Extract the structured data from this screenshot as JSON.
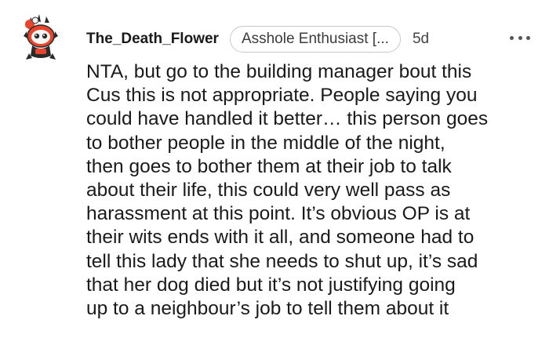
{
  "comment": {
    "author": "The_Death_Flower",
    "flair": "Asshole Enthusiast [...",
    "age": "5d",
    "avatar_icon": "snoo-avatar-icon",
    "more_icon": "more-options-icon",
    "body_lines": [
      "NTA, but go to the building manager bout this",
      "Cus this is not appropriate. People saying you",
      "could have handled it better… this person goes",
      "to bother people in the middle of the night,",
      "then goes to bother them at their job to talk",
      "about their life, this could very well pass as",
      "harassment at this point. It’s obvious OP is at",
      "their wits ends with it all, and someone had to",
      "tell this lady that she needs to shut up, it’s sad",
      "that her dog died but it’s not justifying going",
      "up to a neighbour’s job to tell them about it"
    ]
  },
  "colors": {
    "background": "#ffffff",
    "text": "#1a1a1b",
    "flair_border": "#c9c9c9",
    "avatar_accent": "#e8452c"
  }
}
